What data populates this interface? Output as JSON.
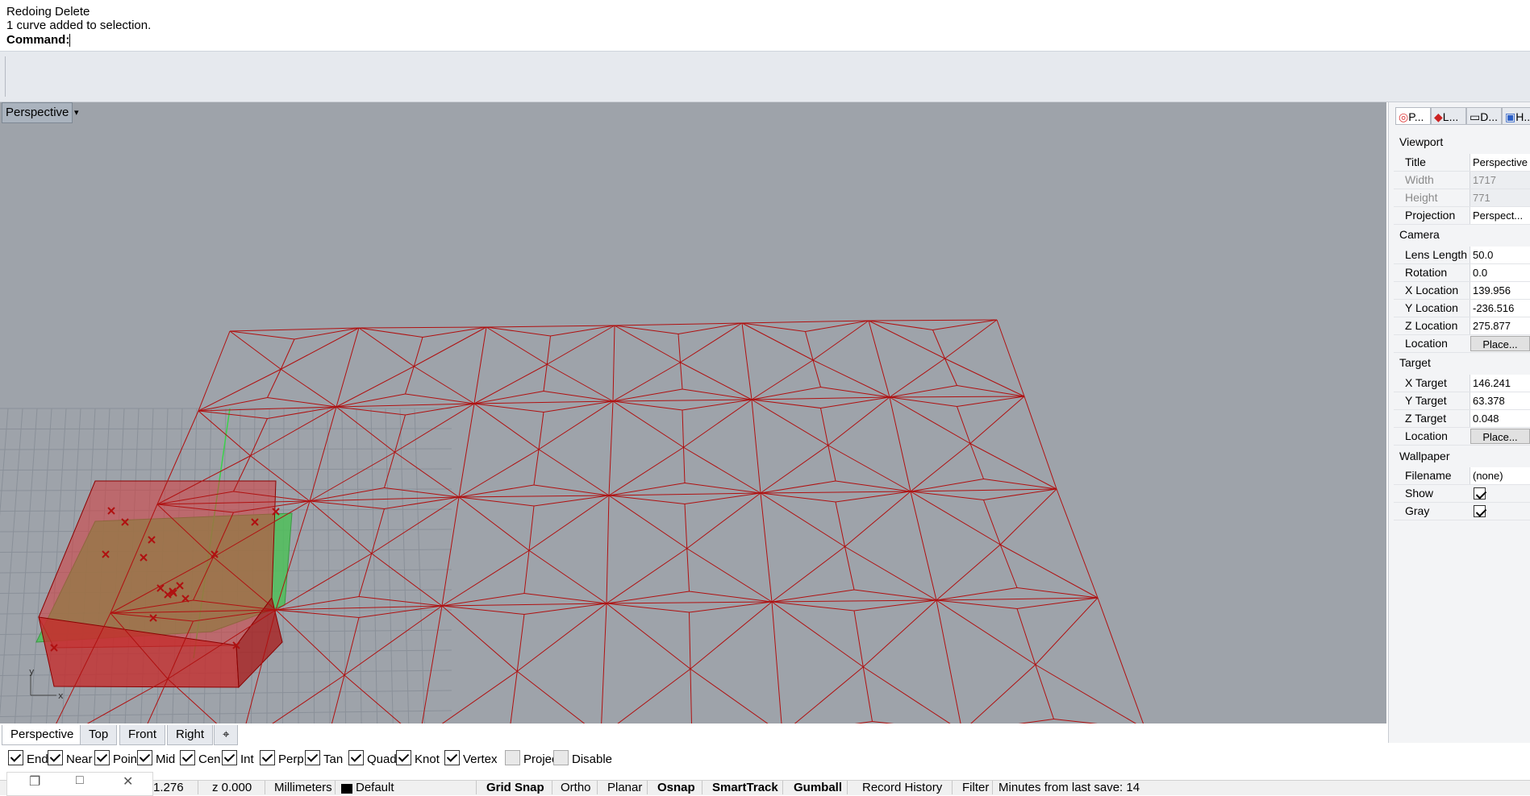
{
  "command_history": {
    "line1": "Redoing Delete",
    "line2": "1 curve added to selection.",
    "prompt_label": "Command:"
  },
  "viewport": {
    "title": "Perspective",
    "dropdown": "▾",
    "axis_x": "x",
    "axis_y": "y"
  },
  "viewport_tabs": [
    "Perspective",
    "Top",
    "Front",
    "Right",
    "⌖"
  ],
  "osnap": {
    "items": [
      {
        "label": "End",
        "checked": true
      },
      {
        "label": "Near",
        "checked": true
      },
      {
        "label": "Point",
        "checked": true
      },
      {
        "label": "Mid",
        "checked": true
      },
      {
        "label": "Cen",
        "checked": true
      },
      {
        "label": "Int",
        "checked": true
      },
      {
        "label": "Perp",
        "checked": true
      },
      {
        "label": "Tan",
        "checked": true
      },
      {
        "label": "Quad",
        "checked": true
      },
      {
        "label": "Knot",
        "checked": true
      },
      {
        "label": "Vertex",
        "checked": true
      },
      {
        "label": "Project",
        "checked": false
      },
      {
        "label": "Disable",
        "checked": false
      }
    ]
  },
  "status_bar": {
    "x_coord": "1.276",
    "z_coord": "z 0.000",
    "units": "Millimeters",
    "layer": "Default",
    "grid_snap": "Grid Snap",
    "ortho": "Ortho",
    "planar": "Planar",
    "osnap": "Osnap",
    "smarttrack": "SmartTrack",
    "gumball": "Gumball",
    "record_history": "Record History",
    "filter": "Filter",
    "last_save": "Minutes from last save: 14"
  },
  "panel": {
    "tabs": [
      "P...",
      "L...",
      "D...",
      "H..."
    ],
    "viewport_section": "Viewport",
    "camera_section": "Camera",
    "target_section": "Target",
    "wallpaper_section": "Wallpaper",
    "rows": {
      "title": {
        "label": "Title",
        "value": "Perspective"
      },
      "width": {
        "label": "Width",
        "value": "1717"
      },
      "height": {
        "label": "Height",
        "value": "771"
      },
      "projection": {
        "label": "Projection",
        "value": "Perspect..."
      },
      "lens_length": {
        "label": "Lens Length",
        "value": "50.0"
      },
      "rotation": {
        "label": "Rotation",
        "value": "0.0"
      },
      "x_location": {
        "label": "X Location",
        "value": "139.956"
      },
      "y_location": {
        "label": "Y Location",
        "value": "-236.516"
      },
      "z_location": {
        "label": "Z Location",
        "value": "275.877"
      },
      "cam_location": {
        "label": "Location",
        "button": "Place..."
      },
      "x_target": {
        "label": "X Target",
        "value": "146.241"
      },
      "y_target": {
        "label": "Y Target",
        "value": "63.378"
      },
      "z_target": {
        "label": "Z Target",
        "value": "0.048"
      },
      "tgt_location": {
        "label": "Location",
        "button": "Place..."
      },
      "filename": {
        "label": "Filename",
        "value": "(none)"
      },
      "show": {
        "label": "Show",
        "checked": true
      },
      "gray": {
        "label": "Gray",
        "checked": true
      }
    }
  },
  "colors": {
    "viewport_bg": "#9ea3aa",
    "mesh_red": "#b01010",
    "box_fill": "#d63a3a",
    "plane_green": "#4fbf5a"
  }
}
